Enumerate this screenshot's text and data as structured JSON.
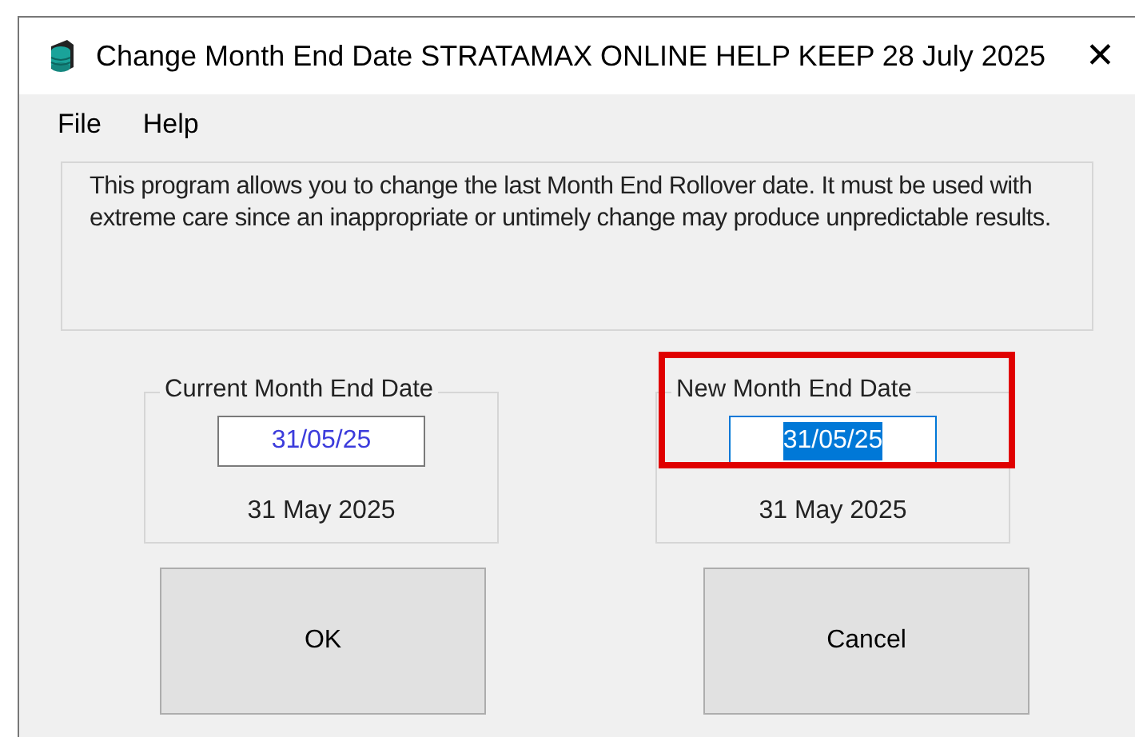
{
  "window": {
    "title": "Change Month End Date STRATAMAX ONLINE HELP KEEP 28 July 2025",
    "close": "✕"
  },
  "menu": [
    "File",
    "Help"
  ],
  "description": "This program allows you to change the last Month End Rollover date. It must be used with extreme care since an inappropriate or untimely change may produce unpredictable results.",
  "groups": [
    {
      "label": "Current Month End Date",
      "value": "31/05/25",
      "text_selected": false,
      "focused": false,
      "highlighted": false,
      "long_date": "31 May 2025"
    },
    {
      "label": "New Month End Date",
      "value": "31/05/25",
      "text_selected": true,
      "focused": true,
      "highlighted": true,
      "long_date": "31 May 2025"
    }
  ],
  "buttons": [
    "OK",
    "Cancel"
  ]
}
